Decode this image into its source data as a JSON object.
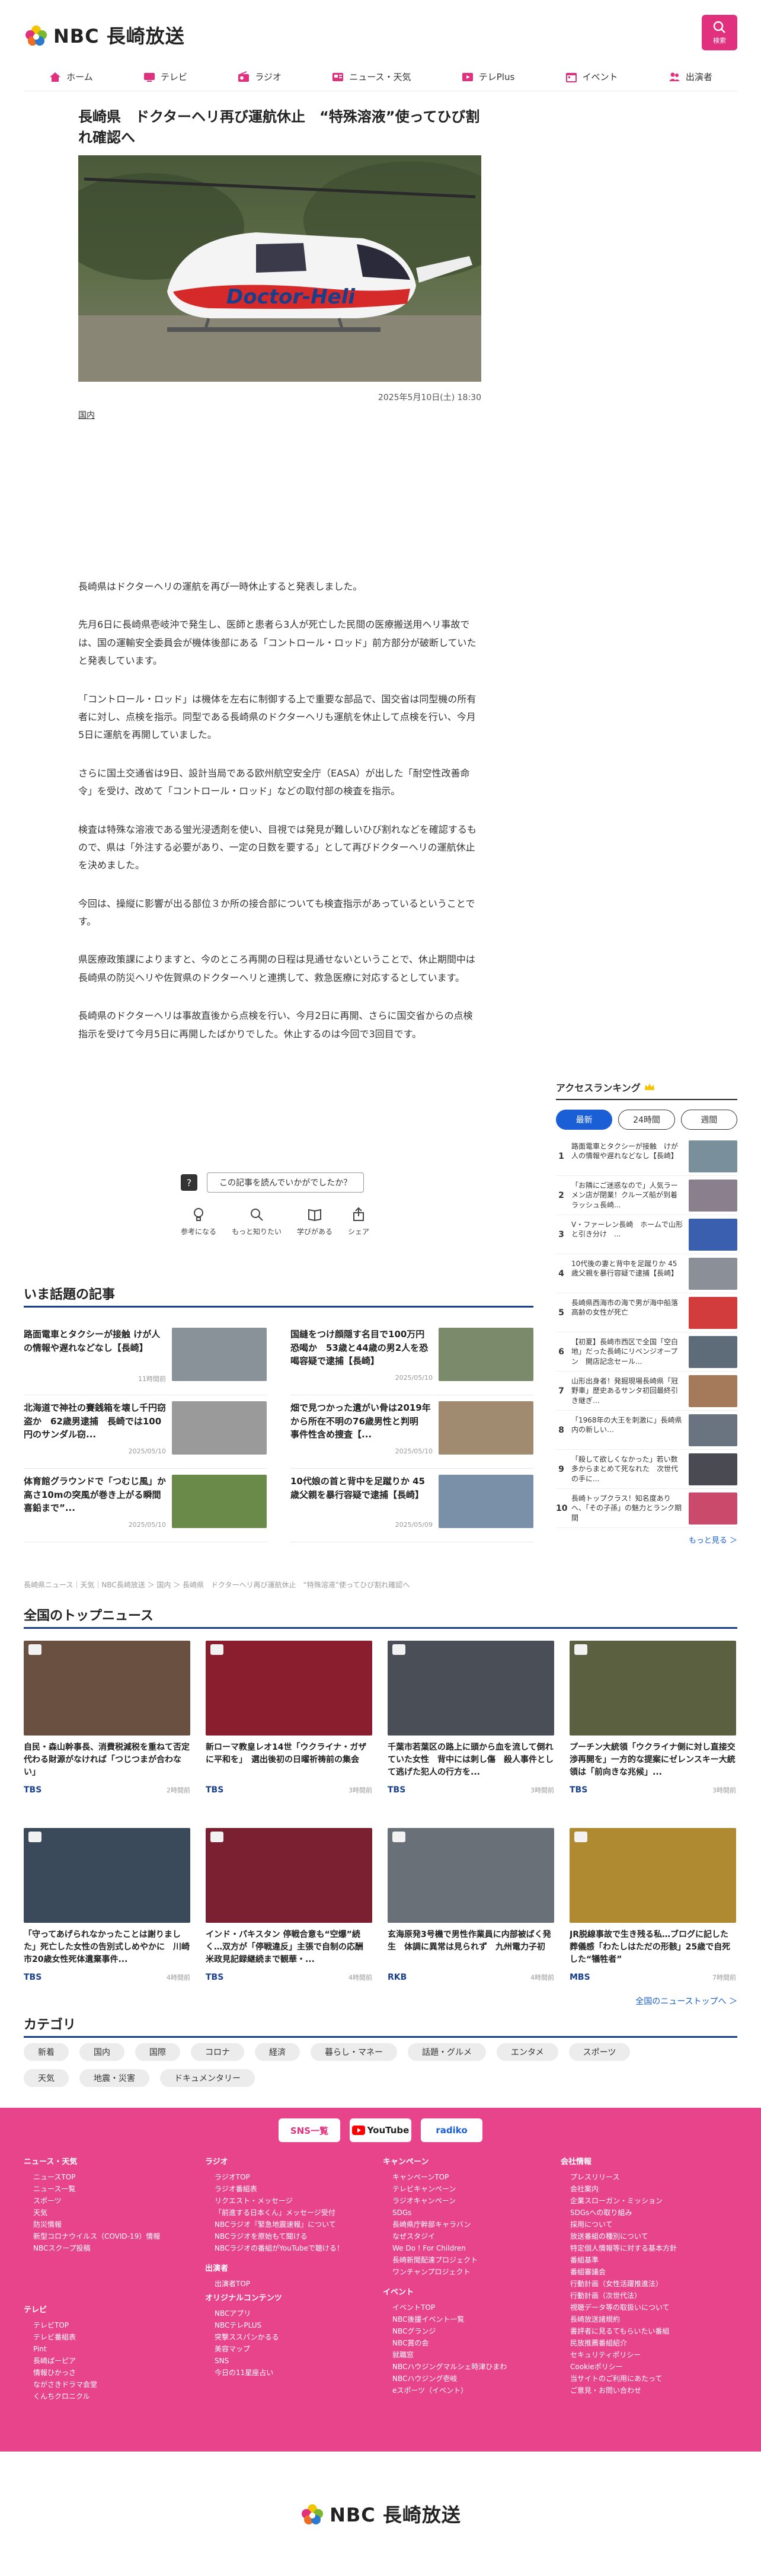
{
  "header": {
    "logo_text": "NBC 長崎放送",
    "search_label": "検索"
  },
  "nav": [
    {
      "label": "ホーム",
      "icon": "home-icon"
    },
    {
      "label": "テレビ",
      "icon": "tv-icon"
    },
    {
      "label": "ラジオ",
      "icon": "radio-icon"
    },
    {
      "label": "ニュース・天気",
      "icon": "news-icon"
    },
    {
      "label": "テレPlus",
      "icon": "play-icon"
    },
    {
      "label": "イベント",
      "icon": "calendar-icon"
    },
    {
      "label": "出演者",
      "icon": "people-icon"
    }
  ],
  "article": {
    "title": "長崎県　ドクターヘリ再び運航休止　“特殊溶液”使ってひび割れ確認へ",
    "date": "2025年5月10日(土) 18:30",
    "category": "国内",
    "paragraphs": [
      "長崎県はドクターヘリの運航を再び一時休止すると発表しました。",
      "先月6日に長崎県壱岐沖で発生し、医師と患者ら3人が死亡した民間の医療搬送用ヘリ事故では、国の運輸安全委員会が機体後部にある「コントロール・ロッド」前方部分が破断していたと発表しています。",
      "「コントロール・ロッド」は機体を左右に制御する上で重要な部品で、国交省は同型機の所有者に対し、点検を指示。同型である長崎県のドクターヘリも運航を休止して点検を行い、今月5日に運航を再開していました。",
      "さらに国土交通省は9日、設計当局である欧州航空安全庁（EASA）が出した「耐空性改善命令」を受け、改めて「コントロール・ロッド」などの取付部の検査を指示。",
      "検査は特殊な溶液である蛍光浸透剤を使い、目視では発見が難しいひび割れなどを確認するもので、県は「外注する必要があり、一定の日数を要する」として再びドクターヘリの運航休止を決めました。",
      "今回は、操縦に影響が出る部位３か所の接合部についても検査指示があっているということです。",
      "県医療政策課によりますと、今のところ再開の日程は見通せないということで、休止期間中は長崎県の防災ヘリや佐賀県のドクターヘリと連携して、救急医療に対応するとしています。",
      "長崎県のドクターヘリは事故直後から点検を行い、今月2日に再開、さらに国交省からの点検指示を受けて今月5日に再開したばかりでした。休止するのは今回で3回目です。"
    ],
    "heli_text": "Doctor-Heli"
  },
  "reaction": {
    "question": "この記事を読んでいかがでしたか？",
    "options": [
      {
        "label": "参考になる",
        "icon": "lightbulb-icon"
      },
      {
        "label": "もっと知りたい",
        "icon": "magnifier-icon"
      },
      {
        "label": "学びがある",
        "icon": "book-icon"
      },
      {
        "label": "シェア",
        "icon": "share-icon"
      }
    ]
  },
  "ranking": {
    "title": "アクセスランキング",
    "tabs": [
      "最新",
      "24時間",
      "週間"
    ],
    "more": "もっと見る ＞",
    "items": [
      {
        "n": "1",
        "text": "路面電車とタクシーが接触　けが人の情報や遅れなどなし【長崎】",
        "color": "#7a8f9c"
      },
      {
        "n": "2",
        "text": "「お隣にご迷惑なので」人気ラーメン店が閉業！クルーズ船が到着ラッシュ長崎...",
        "color": "#8a7f8c"
      },
      {
        "n": "3",
        "text": "V・ファーレン長崎　ホームで山形と引き分け　...",
        "color": "#3a5fae"
      },
      {
        "n": "4",
        "text": "10代後の妻と背中を足蹴りか 45歳父親を暴行容疑で逮捕【長崎】",
        "color": "#8b9098"
      },
      {
        "n": "5",
        "text": "長崎県西海市の海で男が海中船落　高齢の女性が死亡",
        "color": "#d23c3c"
      },
      {
        "n": "6",
        "text": "【初夏】長崎市西区で全国「空白地」だった長崎にリベンジオープン　開店記念セール...",
        "color": "#5e6b78"
      },
      {
        "n": "7",
        "text": "山形出身者！発掘現場長崎県「冠野車」歴史あるサンタ初回最終引き継ぎ…",
        "color": "#a47a5a"
      },
      {
        "n": "8",
        "text": "「1968年の大王を刺激に」長崎県内の新しい…",
        "color": "#6a7480"
      },
      {
        "n": "9",
        "text": "「殺して欲しくなかった」若い数多からまとめて死なれた　次世代の手に...",
        "color": "#4a4a52"
      },
      {
        "n": "10",
        "text": "長崎トップクラス！知名度ありへ、「その子孫」の魅力とランク期間",
        "color": "#c94a6a"
      }
    ]
  },
  "topic": {
    "title": "いま話題の記事",
    "items": [
      {
        "title": "路面電車とタクシーが接触 けが人の情報や遅れなどなし【長崎】",
        "date": "11時間前",
        "color": "#8a9299"
      },
      {
        "title": "国縫をつけ顔隠す名目で100万円恐喝か　53歳と44歳の男2人を恐喝容疑で逮捕【長崎】",
        "date": "2025/05/10",
        "color": "#7b8a6a"
      },
      {
        "title": "北海道で神社の賽銭箱を壊し千円窃盗か　62歳男逮捕　長崎では100円のサンダル窃...",
        "date": "2025/05/10",
        "color": "#9a9a9a"
      },
      {
        "title": "畑で見つかった遺がい骨は2019年から所在不明の76歳男性と判明　事件性含め捜査【...",
        "date": "2025/05/10",
        "color": "#a08a70"
      },
      {
        "title": "体育館グラウンドで「つむじ風」か　高さ10mの突風が巻き上がる瞬間　喜鉛まで”...",
        "date": "2025/05/10",
        "color": "#6a8a4a"
      },
      {
        "title": "10代娘の首と背中を足蹴りか 45歳父親を暴行容疑で逮捕【長崎】",
        "date": "2025/05/09",
        "color": "#7a8fa8"
      }
    ]
  },
  "breadcrumb": "長崎県ニュース｜天気｜NBC長崎放送 ＞ 国内 ＞ 長崎県　ドクターヘリ再び運航休止　“特殊溶液”使ってひび割れ確認へ",
  "national": {
    "title": "全国のトップニュース",
    "more": "全国のニューストップへ ＞",
    "items": [
      {
        "title": "自民・森山幹事長、消費税減税を重ねて否定　代わる財源がなければ「つじつまが合わない」",
        "src": "TBS",
        "time": "2時間前",
        "color": "#6a5040"
      },
      {
        "title": "新ローマ教皇レオ14世「ウクライナ・ガザに平和を」　選出後初の日曜祈祷前の集会",
        "src": "TBS",
        "time": "3時間前",
        "color": "#8a1e2e"
      },
      {
        "title": "千葉市若葉区の路上に頭から血を流して倒れていた女性　背中には刺し傷　殺人事件として逃げた犯人の行方を...",
        "src": "TBS",
        "time": "3時間前",
        "color": "#4a4e56"
      },
      {
        "title": "プーチン大統領「ウクライナ側に対し直接交渉再開を」一方的な提案にゼレンスキー大統領は「前向きな兆候」...",
        "src": "TBS",
        "time": "3時間前",
        "color": "#5a6040"
      },
      {
        "title": "「守ってあげられなかったことは謝りました」死亡した女性の告別式しめやかに　川崎市20歳女性死体遺棄事件...",
        "src": "TBS",
        "time": "4時間前",
        "color": "#3a4a5a"
      },
      {
        "title": "インド・パキスタン 停戦合意も“空爆”続く…双方が「停戦違反」主張で自制の応酬　米政見記録継続まで観華・...",
        "src": "TBS",
        "time": "4時間前",
        "color": "#7a2030"
      },
      {
        "title": "玄海原発3号機で男性作業員に内部被ばく発生　体調に異常は見られず　九州電力子初",
        "src": "RKB",
        "time": "4時間前",
        "color": "#6a7078"
      },
      {
        "title": "JR脱線事故で生き残る私…ブログに記した葬儀感「わたしはただの形骸」25歳で自死した“犠牲者”",
        "src": "MBS",
        "time": "7時間前",
        "color": "#b08a30"
      }
    ]
  },
  "category": {
    "title": "カテゴリ",
    "row1": [
      "新着",
      "国内",
      "国際",
      "コロナ",
      "経済",
      "暮らし・マネー",
      "話題・グルメ",
      "エンタメ",
      "スポーツ"
    ],
    "row2": [
      "天気",
      "地震・災害",
      "ドキュメンタリー"
    ]
  },
  "footer": {
    "sns": [
      "SNS一覧",
      "YouTube",
      "radiko"
    ],
    "cols": [
      {
        "h": "ニュース・天気",
        "items": [
          "ニュースTOP",
          "ニュース一覧",
          "スポーツ",
          "天気",
          "防災情報",
          "新型コロナウイルス（COVID-19）情報",
          "NBCスクープ投稿"
        ]
      },
      {
        "h": "テレビ",
        "items": [
          "テレビTOP",
          "テレビ番組表",
          "Pint",
          "長崎ぱーピア",
          "情報ひかっさ",
          "ながさきドラマ会堂",
          "くんちクロニクル"
        ]
      },
      {
        "h": "ラジオ",
        "items": [
          "ラジオTOP",
          "ラジオ番組表",
          "リクエスト・メッセージ",
          "「前進する日本くん」メッセージ受付",
          "NBCラジオ『緊急地震速報』について",
          "NBCラジオを原始もて聞ける",
          "NBCラジオの番組がYouTubeで聴ける！"
        ]
      },
      {
        "h": "出演者",
        "items": [
          "出演者TOP"
        ]
      },
      {
        "h": "オリジナルコンテンツ",
        "items": [
          "NBCアプリ",
          "NBCテレPLUS",
          "突撃ススパンかるる",
          "美容マップ",
          "SNS",
          "今日の11星座占い"
        ]
      },
      {
        "h": "キャンペーン",
        "items": [
          "キャンペーンTOP",
          "テレビキャンペーン",
          "ラジオキャンペーン",
          "SDGs",
          "長崎県庁幹部キャラバン",
          "なぜスタジイ",
          "We Do ! For Children",
          "長崎新聞配達プロジェクト",
          "ワンチャンプロジェクト"
        ]
      },
      {
        "h": "イベント",
        "items": [
          "イベントTOP",
          "NBC後援イベント一覧",
          "NBCグランジ",
          "NBC賞の会",
          "就職窓",
          "NBCハウジングマルシェ時津ひまわ",
          "NBCハウジング壱岐",
          "eスポーツ（イベント）"
        ]
      },
      {
        "h": "会社情報",
        "items": [
          "プレスリリース",
          "会社案内",
          "企業スローガン・ミッション",
          "SDGsへの取り組み",
          "採用について",
          "放送番組の種別について",
          "特定個人情報等に対する基本方針",
          "番組基準",
          "番組審議会",
          "行動計画（女性活躍推進法）",
          "行動計画（次世代法）",
          "視聴データ等の取扱いについて",
          "長崎放送諸規約",
          "書評者に見るてもらいたい番組",
          "民放推薦番組紹介",
          "セキュリティポリシー",
          "Cookieポリシー",
          "当サイトのご利用にあたって",
          "ご意見・お問い合わせ"
        ]
      }
    ]
  }
}
